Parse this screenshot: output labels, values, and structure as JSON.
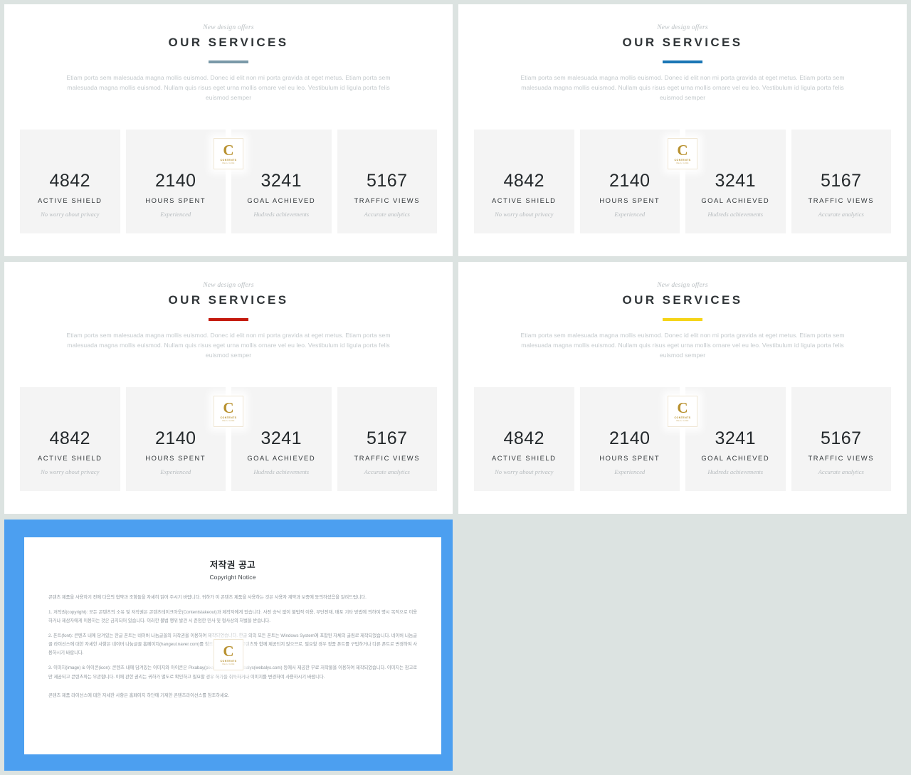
{
  "slides": [
    {
      "eyebrow": "New design offers",
      "headline": "OUR SERVICES",
      "accent": "#7a99a8",
      "lede": "Etiam porta sem malesuada magna mollis euismod. Donec id elit non mi porta gravida at eget metus. Etiam porta sem malesuada magna mollis euismod. Nullam quis risus eget urna mollis ornare vel eu leo. Vestibulum id ligula porta felis euismod semper",
      "stats": [
        {
          "value": "4842",
          "label": "ACTIVE SHIELD",
          "sub": "No worry about privacy"
        },
        {
          "value": "2140",
          "label": "HOURS SPENT",
          "sub": "Experienced"
        },
        {
          "value": "3241",
          "label": "GOAL ACHIEVED",
          "sub": "Hudreds achievements"
        },
        {
          "value": "5167",
          "label": "TRAFFIC VIEWS",
          "sub": "Accurate analytics"
        }
      ]
    },
    {
      "eyebrow": "New design offers",
      "headline": "OUR SERVICES",
      "accent": "#1a76b5",
      "lede": "Etiam porta sem malesuada magna mollis euismod. Donec id elit non mi porta gravida at eget metus. Etiam porta sem malesuada magna mollis euismod. Nullam quis risus eget urna mollis ornare vel eu leo. Vestibulum id ligula porta felis euismod semper",
      "stats": [
        {
          "value": "4842",
          "label": "ACTIVE SHIELD",
          "sub": "No worry about privacy"
        },
        {
          "value": "2140",
          "label": "HOURS SPENT",
          "sub": "Experienced"
        },
        {
          "value": "3241",
          "label": "GOAL ACHIEVED",
          "sub": "Hudreds achievements"
        },
        {
          "value": "5167",
          "label": "TRAFFIC VIEWS",
          "sub": "Accurate analytics"
        }
      ]
    },
    {
      "eyebrow": "New design offers",
      "headline": "OUR SERVICES",
      "accent": "#c41a0e",
      "lede": "Etiam porta sem malesuada magna mollis euismod. Donec id elit non mi porta gravida at eget metus. Etiam porta sem malesuada magna mollis euismod. Nullam quis risus eget urna mollis ornare vel eu leo. Vestibulum id ligula porta felis euismod semper",
      "stats": [
        {
          "value": "4842",
          "label": "ACTIVE SHIELD",
          "sub": "No worry about privacy"
        },
        {
          "value": "2140",
          "label": "HOURS SPENT",
          "sub": "Experienced"
        },
        {
          "value": "3241",
          "label": "GOAL ACHIEVED",
          "sub": "Hudreds achievements"
        },
        {
          "value": "5167",
          "label": "TRAFFIC VIEWS",
          "sub": "Accurate analytics"
        }
      ]
    },
    {
      "eyebrow": "New design offers",
      "headline": "OUR SERVICES",
      "accent": "#f5d417",
      "lede": "Etiam porta sem malesuada magna mollis euismod. Donec id elit non mi porta gravida at eget metus. Etiam porta sem malesuada magna mollis euismod. Nullam quis risus eget urna mollis ornare vel eu leo. Vestibulum id ligula porta felis euismod semper",
      "stats": [
        {
          "value": "4842",
          "label": "ACTIVE SHIELD",
          "sub": "No worry about privacy"
        },
        {
          "value": "2140",
          "label": "HOURS SPENT",
          "sub": "Experienced"
        },
        {
          "value": "3241",
          "label": "GOAL ACHIEVED",
          "sub": "Hudreds achievements"
        },
        {
          "value": "5167",
          "label": "TRAFFIC VIEWS",
          "sub": "Accurate analytics"
        }
      ]
    }
  ],
  "watermark": {
    "letter": "C",
    "name": "CONTENTS",
    "tagline": "REAL  CARE"
  },
  "copyright_slide": {
    "title": "저작권 공고",
    "subtitle": "Copyright Notice",
    "intro": "콘텐츠 제품을 사용하기 전에 다음의 협약과 조항들을 자세히 읽어 주시기 바랍니다. 귀하가 이 콘텐츠 제품을 사용하는 것은 사용자 계약과 보증에 동의하셨음을 알려드립니다.",
    "paragraphs": [
      "1. 저작권(copyright): 모든 콘텐츠의 소유 및 저작권은 콘텐츠테이크아웃(Contentstakeout)과 제작자에게 있습니다. 사전 승낙 없이 불법적 이용, 무단전재, 배포 기타 방법에 의하여 명시 목적으로 이용하거나 제삼자에게 이용하는 것은 금지되어 있습니다. 이러한 불법 행위 발견 시 준엄한 민사 및 형사상의 처벌을 받습니다.",
      "2. 폰트(font): 콘텐츠 내에 담겨있는 한글 폰트는 네이버 나눔글꼴의 저작권을 이용하여 제작되었습니다. 한글 외의 모든 폰트는 Windows System에 포함된 자체의 굴림로 제작되었습니다. 네이버 나눔글꼴 라이선스에 대한 자세한 사항은 네이버 나눔글꼴 홈페이지(hangeul.naver.com)를 참조하세요. 폰트는 콘텐츠와 함께 제공되지 않으므로, 필요할 경우 정품 폰트를 구입하거나 다른 폰트로 변경하여 사용하시기 바랍니다.",
      "3. 이미지(image) & 아이콘(icon): 콘텐츠 내에 담겨있는 이미지와 아이콘은 Pixabay(pixabay.com)와 Webalys(webalys.com) 등에서 제공한 무료 저작물을 이용하여 제작되었습니다. 이미지는 참고로만 제공되고 콘텐츠와는 무관합니다. 이에 관한 권리는 귀하가 별도로 확인하고 필요할 경우 허가를 취득하거나 이미지를 변경하여 사용하시기 바랍니다."
    ],
    "footer": "콘텐츠 제품 라이선스에 대한 자세한 사항은 홈페이지 하단에 기재한 콘텐츠라이선스를 참조하세요.",
    "frame_color": "#4c9ff0",
    "frame_color_lower": "#aadcfb"
  }
}
